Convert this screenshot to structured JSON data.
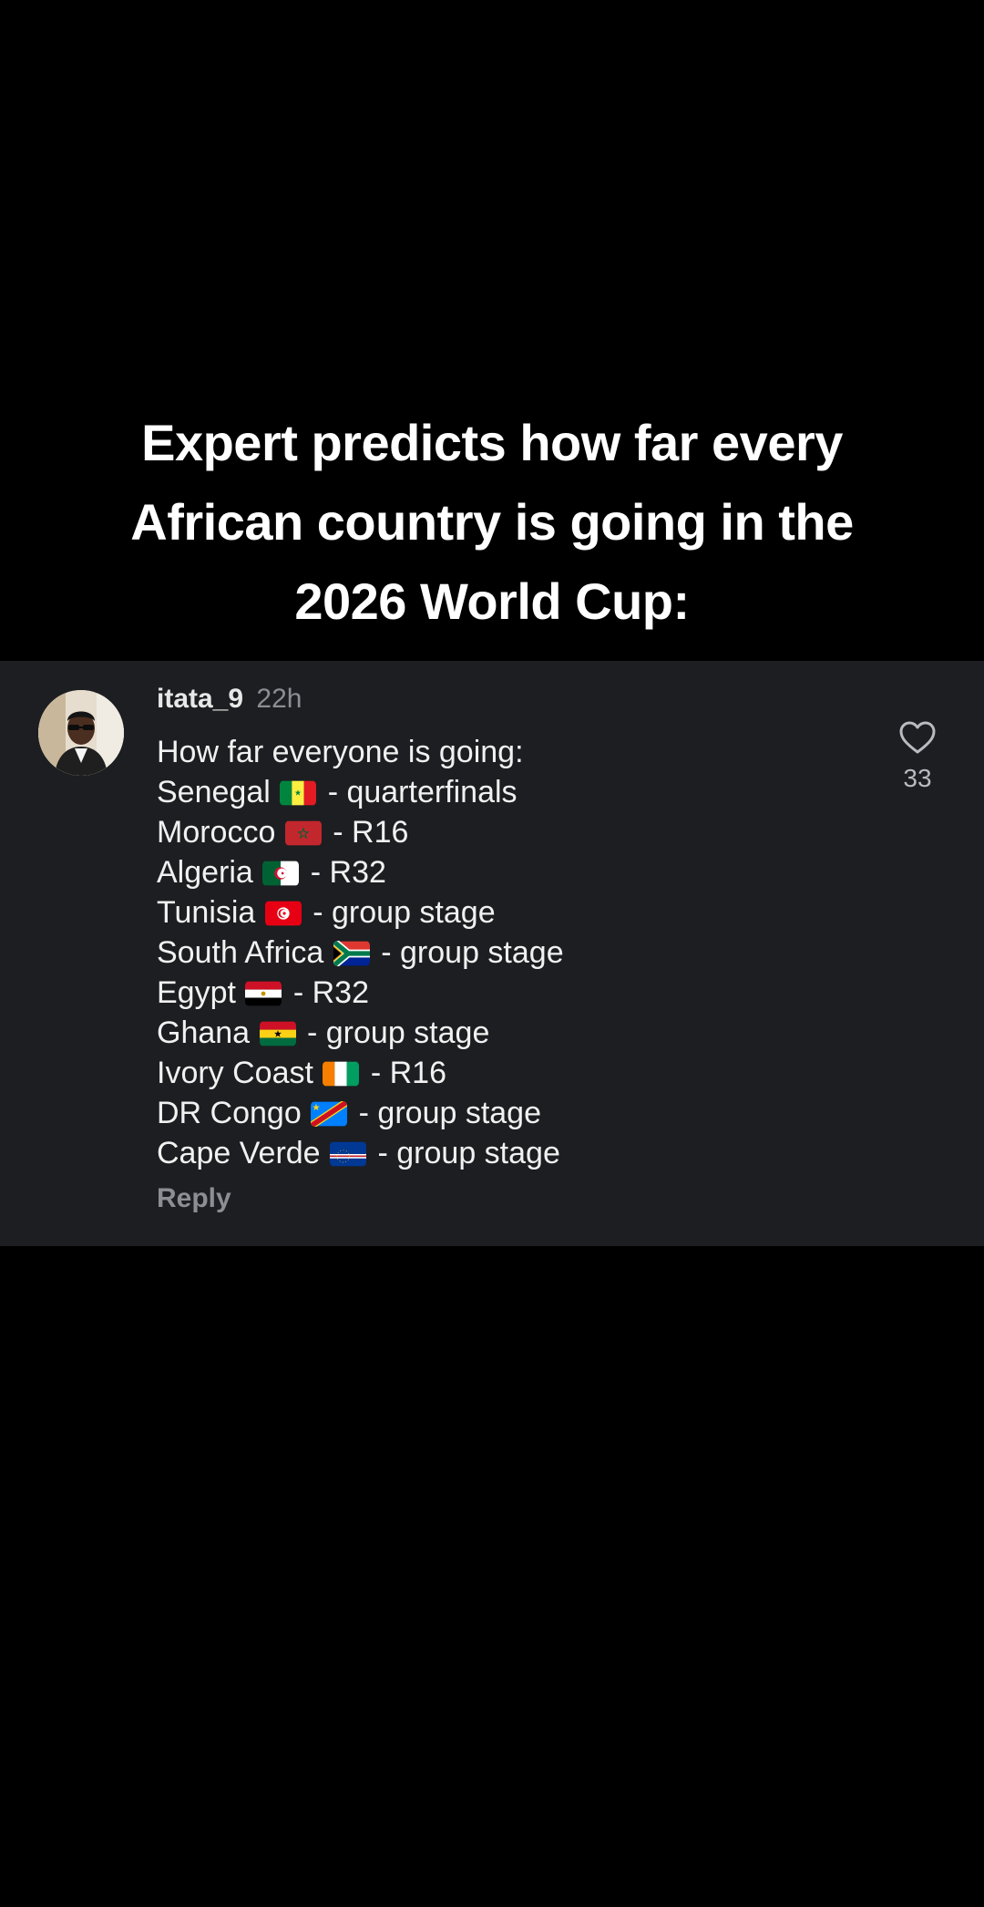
{
  "headline": {
    "lines": [
      "Expert predicts how far every",
      "African country is going in the",
      "2026 World Cup:"
    ]
  },
  "comment": {
    "username": "itata_9",
    "timestamp": "22h",
    "intro": "How far everyone is going:",
    "entries": [
      {
        "country": "Senegal",
        "flag_icon": "senegal-flag-icon",
        "result": "- quarterfinals"
      },
      {
        "country": "Morocco",
        "flag_icon": "morocco-flag-icon",
        "result": "- R16"
      },
      {
        "country": "Algeria",
        "flag_icon": "algeria-flag-icon",
        "result": "- R32"
      },
      {
        "country": "Tunisia",
        "flag_icon": "tunisia-flag-icon",
        "result": "- group stage"
      },
      {
        "country": "South Africa",
        "flag_icon": "south-africa-flag-icon",
        "result": "- group stage"
      },
      {
        "country": "Egypt",
        "flag_icon": "egypt-flag-icon",
        "result": "- R32"
      },
      {
        "country": "Ghana",
        "flag_icon": "ghana-flag-icon",
        "result": "- group stage"
      },
      {
        "country": "Ivory Coast",
        "flag_icon": "ivory-coast-flag-icon",
        "result": "- R16"
      },
      {
        "country": "DR Congo",
        "flag_icon": "dr-congo-flag-icon",
        "result": "- group stage"
      },
      {
        "country": "Cape Verde",
        "flag_icon": "cape-verde-flag-icon",
        "result": "- group stage"
      }
    ],
    "reply_label": "Reply",
    "like_icon": "heart-outline-icon",
    "like_count": "33"
  },
  "colors": {
    "background": "#000000",
    "card": "#1c1e21",
    "text": "#f1f1f1",
    "muted": "#8b8e93"
  }
}
